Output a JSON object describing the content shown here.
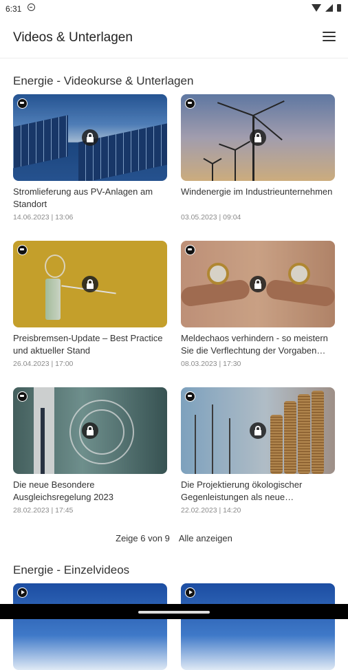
{
  "status_bar": {
    "time": "6:31"
  },
  "app_bar": {
    "title": "Videos & Unterlagen"
  },
  "sections": [
    {
      "title": "Energie - Videokurse & Unterlagen",
      "cards": [
        {
          "title": "Stromlieferung aus PV-Anlagen am Standort",
          "date": "14.06.2023 | 13:06",
          "thumbnail": "solar-panels",
          "badge_icon": "graduation-cap-icon",
          "locked": true
        },
        {
          "title": "Windenergie im Industrieunternehmen",
          "date": "03.05.2023 | 09:04",
          "thumbnail": "wind-turbines",
          "badge_icon": "graduation-cap-icon",
          "locked": true
        },
        {
          "title": "Preisbremsen-Update – Best Practice und aktueller Stand",
          "date": "26.04.2023 | 17:00",
          "thumbnail": "lightbulb-money-plug",
          "badge_icon": "graduation-cap-icon",
          "locked": true
        },
        {
          "title": "Meldechaos verhindern - so meistern Sie die Verflechtung der Vorgaben au…",
          "date": "08.03.2023 | 17:30",
          "thumbnail": "hands-with-clocks",
          "badge_icon": "graduation-cap-icon",
          "locked": true
        },
        {
          "title": "Die neue Besondere Ausgleichsregelung 2023",
          "date": "28.02.2023 | 17:45",
          "thumbnail": "digital-document-touch",
          "badge_icon": "graduation-cap-icon",
          "locked": true
        },
        {
          "title": "Die Projektierung ökologischer Gegenleistungen als neue Vorausset…",
          "date": "22.02.2023 | 14:20",
          "thumbnail": "pylons-and-coins",
          "badge_icon": "graduation-cap-icon",
          "locked": true
        }
      ],
      "pagination": {
        "count_label": "Zeige 6 von 9",
        "show_all_label": "Alle anzeigen"
      }
    },
    {
      "title": "Energie - Einzelvideos",
      "cards": [
        {
          "thumbnail": "blue-sky",
          "badge_icon": "play-icon"
        },
        {
          "thumbnail": "blue-sky",
          "badge_icon": "play-icon"
        }
      ]
    }
  ],
  "colors": {
    "text": "#333333",
    "date": "#8a8a8a",
    "lock_bg": "#1e1e1e"
  }
}
